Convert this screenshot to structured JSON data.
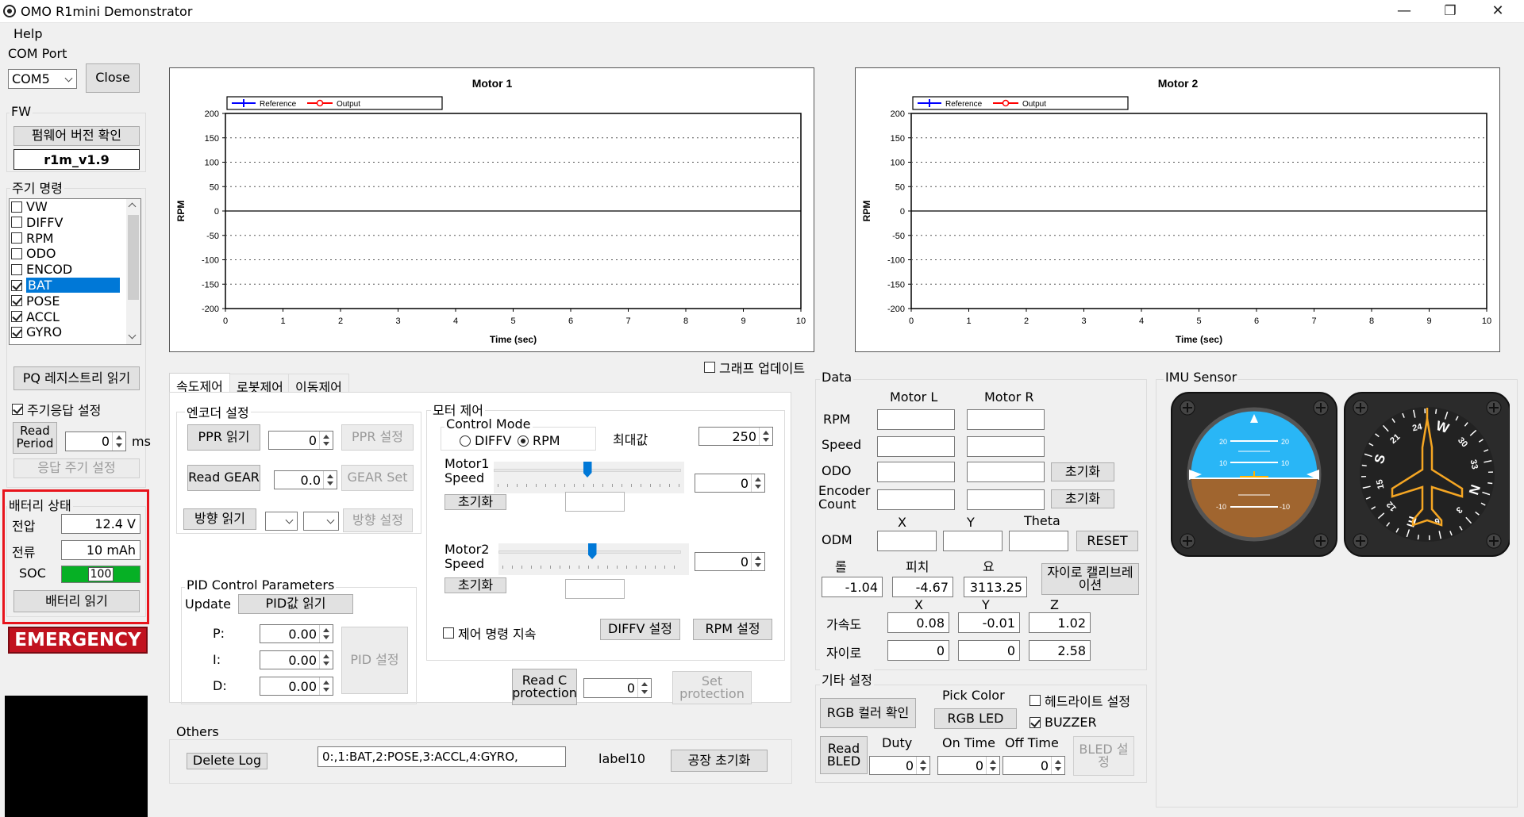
{
  "window": {
    "title": "OMO R1mini Demonstrator",
    "minimize": "—",
    "restore": "❐",
    "close": "✕"
  },
  "menu": {
    "help": "Help"
  },
  "com": {
    "group": "COM Port",
    "port": "COM5",
    "close_btn": "Close"
  },
  "fw": {
    "group": "FW",
    "check_btn": "펌웨어 버전 확인",
    "version": "r1m_v1.9"
  },
  "cycle": {
    "group": "주기 명령",
    "items": [
      {
        "label": "VW",
        "checked": false
      },
      {
        "label": "DIFFV",
        "checked": false
      },
      {
        "label": "RPM",
        "checked": false
      },
      {
        "label": "ODO",
        "checked": false
      },
      {
        "label": "ENCOD",
        "checked": false
      },
      {
        "label": "BAT",
        "checked": true,
        "selected": true
      },
      {
        "label": "POSE",
        "checked": true
      },
      {
        "label": "ACCL",
        "checked": true
      },
      {
        "label": "GYRO",
        "checked": true
      }
    ],
    "pq_btn": "PQ 레지스트리 읽기",
    "resp_label": "주기응답 설정",
    "read_period_btn": "Read Period",
    "period_value": "0",
    "period_unit": "ms",
    "set_period_btn": "응답 주기 설정"
  },
  "battery": {
    "group": "배터리 상태",
    "voltage_label": "전압",
    "voltage": "12.4 V",
    "current_label": "전류",
    "current": "10 mAh",
    "soc_label": "SOC",
    "soc": "100",
    "soc_fraction": 1.0,
    "read_btn": "배터리 읽기",
    "highlight_color": "#e8141c"
  },
  "emergency": {
    "label": "EMERGENCY",
    "color": "#c1121f"
  },
  "charts": {
    "motor1": {
      "title": "Motor 1",
      "ylabel": "RPM",
      "xlabel": "Time (sec)",
      "legend": [
        "Reference",
        "Output"
      ]
    },
    "motor2": {
      "title": "Motor 2",
      "ylabel": "RPM",
      "xlabel": "Time (sec)",
      "legend": [
        "Reference",
        "Output"
      ]
    }
  },
  "chart_data": [
    {
      "type": "line",
      "title": "Motor 1",
      "xlabel": "Time (sec)",
      "ylabel": "RPM",
      "xlim": [
        0,
        10
      ],
      "ylim": [
        -200,
        200
      ],
      "xticks": [
        "0",
        "1",
        "2",
        "3",
        "4",
        "5",
        "6",
        "7",
        "8",
        "9",
        "10"
      ],
      "yticks": [
        "200",
        "150",
        "100",
        "50",
        "0",
        "-50",
        "-100",
        "-150",
        "-200"
      ],
      "series": [
        {
          "name": "Reference",
          "color": "#0000ff",
          "x": [],
          "y": []
        },
        {
          "name": "Output",
          "color": "#ff0000",
          "x": [],
          "y": []
        }
      ],
      "grid": true,
      "legend_position": "top-left"
    },
    {
      "type": "line",
      "title": "Motor 2",
      "xlabel": "Time (sec)",
      "ylabel": "RPM",
      "xlim": [
        0,
        10
      ],
      "ylim": [
        -200,
        200
      ],
      "xticks": [
        "0",
        "1",
        "2",
        "3",
        "4",
        "5",
        "6",
        "7",
        "8",
        "9",
        "10"
      ],
      "yticks": [
        "200",
        "150",
        "100",
        "50",
        "0",
        "-50",
        "-100",
        "-150",
        "-200"
      ],
      "series": [
        {
          "name": "Reference",
          "color": "#0000ff",
          "x": [],
          "y": []
        },
        {
          "name": "Output",
          "color": "#ff0000",
          "x": [],
          "y": []
        }
      ],
      "grid": true,
      "legend_position": "top-left"
    }
  ],
  "graph_update": {
    "label": "그래프 업데이트"
  },
  "tabs": [
    "속도제어",
    "로봇제어",
    "이동제어"
  ],
  "encoder": {
    "group": "엔코더 설정",
    "ppr_read": "PPR 읽기",
    "ppr_value": "0",
    "ppr_set": "PPR 설정",
    "gear_read": "Read GEAR",
    "gear_value": "0.0",
    "gear_set": "GEAR Set",
    "dir_read": "방향 읽기",
    "dir_set": "방향 설정"
  },
  "pid": {
    "group": "PID Control Parameters",
    "update_label": "Update",
    "read_btn": "PID값 읽기",
    "p_label": "P:",
    "p": "0.00",
    "i_label": "I:",
    "i": "0.00",
    "d_label": "D:",
    "d": "0.00",
    "set_btn": "PID 설정"
  },
  "motor": {
    "group": "모터 제어",
    "control_mode": "Control Mode",
    "mode_diffv": "DIFFV",
    "mode_rpm": "RPM",
    "max_label": "최대값",
    "max_value": "250",
    "m1_label": "Motor1 Speed",
    "m1_value": "0",
    "m1_slider": 0.5,
    "m2_label": "Motor2 Speed",
    "m2_value": "0",
    "m2_slider": 0.5,
    "reset1": "초기화",
    "reset2": "초기화",
    "persist_label": "제어 명령 지속",
    "diffv_set": "DIFFV 설정",
    "rpm_set": "RPM 설정"
  },
  "protection": {
    "read_btn": "Read C protection",
    "value": "0",
    "set_btn": "Set protection"
  },
  "others": {
    "group": "Others",
    "delete_btn": "Delete Log",
    "log": "0:,1:BAT,2:POSE,3:ACCL,4:GYRO,",
    "label10": "label10",
    "factory_btn": "공장 초기화"
  },
  "data": {
    "group": "Data",
    "motor_l": "Motor L",
    "motor_r": "Motor R",
    "rpm": "RPM",
    "speed": "Speed",
    "odo": "ODO",
    "encoder": "Encoder Count",
    "reset_odo": "초기화",
    "reset_enc": "초기화",
    "x": "X",
    "y": "Y",
    "theta": "Theta",
    "odm": "ODM",
    "reset": "RESET",
    "roll": "롤",
    "pitch": "피치",
    "yaw": "요",
    "roll_v": "-1.04",
    "pitch_v": "-4.67",
    "yaw_v": "3113.25",
    "gyro_cal": "자이로 캘리브레이션",
    "ax": "X",
    "ay": "Y",
    "az": "Z",
    "accel": "가속도",
    "acc_x": "0.08",
    "acc_y": "-0.01",
    "acc_z": "1.02",
    "gyro": "자이로",
    "gyr_x": "0",
    "gyr_y": "0",
    "gyr_z": "2.58"
  },
  "etc": {
    "group": "기타 설정",
    "rgb_check": "RGB 컬러 확인",
    "pick_color": "Pick Color",
    "rgb_led": "RGB LED",
    "headlight": "헤드라이트 설정",
    "buzzer": "BUZZER",
    "read_bled": "Read BLED",
    "duty": "Duty",
    "on_time": "On Time",
    "off_time": "Off Time",
    "duty_v": "0",
    "on_v": "0",
    "off_v": "0",
    "bled_set": "BLED 설정"
  },
  "imu": {
    "group": "IMU Sensor",
    "att_ticks": [
      "20",
      "20",
      "10",
      "10",
      "-10",
      "-10"
    ],
    "compass_labels": [
      "24",
      "W",
      "30",
      "33",
      "N",
      "3",
      "6",
      "E",
      "12",
      "15",
      "S",
      "21"
    ]
  }
}
